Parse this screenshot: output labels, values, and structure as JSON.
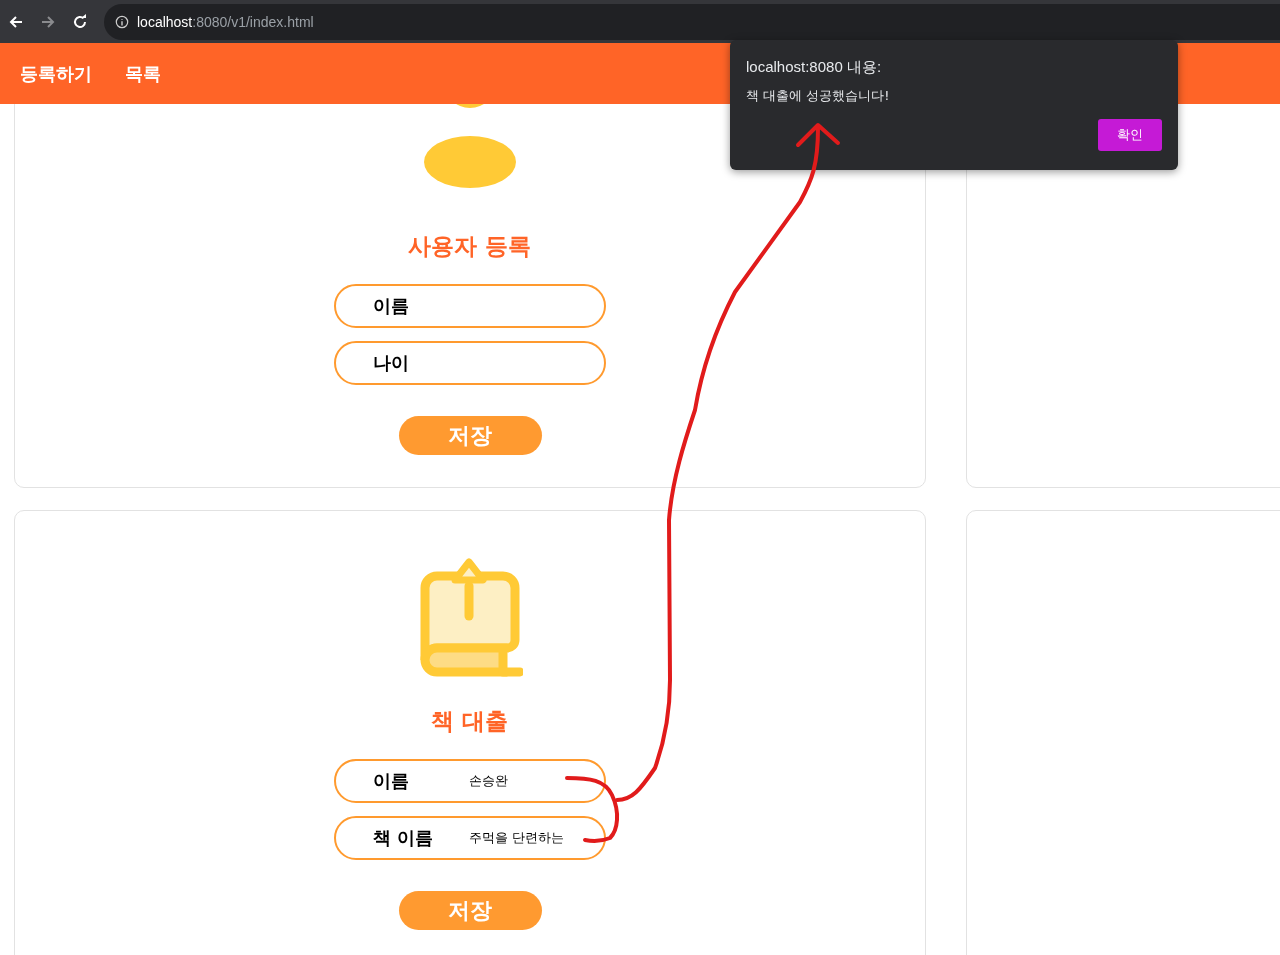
{
  "browser": {
    "url_host": "localhost",
    "url_path": ":8080/v1/index.html"
  },
  "nav": [
    {
      "label": "등록하기"
    },
    {
      "label": "목록"
    }
  ],
  "cards": [
    {
      "kind": "user",
      "title": "사용자 등록",
      "fields": [
        {
          "label": "이름"
        },
        {
          "label": "나이"
        }
      ],
      "button": "저장"
    },
    {
      "kind": "book",
      "title": "책 대출",
      "fields": [
        {
          "label": "이름",
          "value": "손승완"
        },
        {
          "label": "책 이름",
          "value": "주먹을 단련하는"
        }
      ],
      "button": "저장"
    }
  ],
  "dialog": {
    "title": "localhost:8080 내용:",
    "message": "책 대출에 성공했습니다!",
    "button": "확인"
  }
}
